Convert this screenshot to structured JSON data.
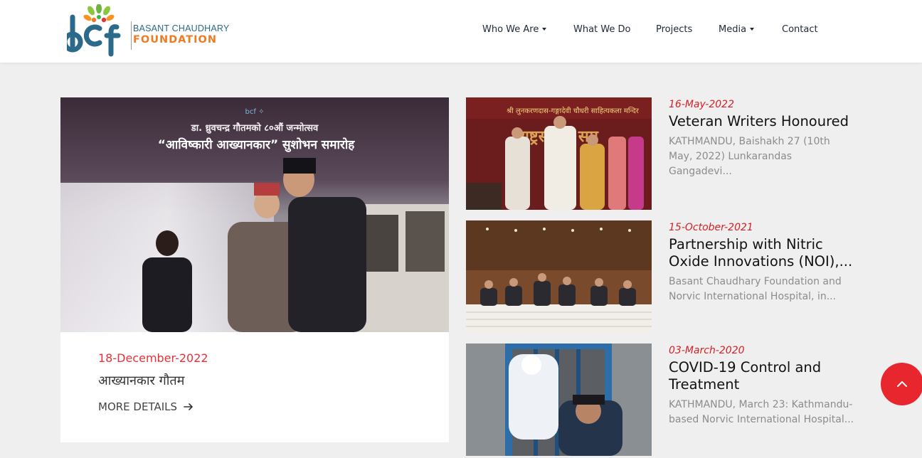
{
  "logo": {
    "line1": "BASANT CHAUDHARY",
    "line2": "FOUNDATION"
  },
  "nav": {
    "items": [
      {
        "label": "Who We Are",
        "dropdown": true
      },
      {
        "label": "What We Do",
        "dropdown": false
      },
      {
        "label": "Projects",
        "dropdown": false
      },
      {
        "label": "Media",
        "dropdown": true
      },
      {
        "label": "Contact",
        "dropdown": false
      }
    ]
  },
  "featured": {
    "date": "18-December-2022",
    "title": "आख्यानकार गौतम",
    "more_label": "MORE DETAILS",
    "image_banner": {
      "line1": "डा. ध्रुवचन्द्र गौतमको ८०औं जन्मोत्सव",
      "line2": "“आविष्कारी आख्यानकार” सुशोभन समारोह"
    }
  },
  "news": [
    {
      "date": "16-May-2022",
      "title": "Veteran Writers Honoured",
      "excerpt": "KATHMANDU, Baishakh 27 (10th May, 2022) Lunkarandas Gangadevi..."
    },
    {
      "date": "15-October-2021",
      "title": "Partnership with Nitric Oxide Innovations (NOI),...",
      "excerpt": "Basant Chaudhary Foundation and Norvic International Hospital, in..."
    },
    {
      "date": "03-March-2020",
      "title": "COVID-19 Control and Treatment",
      "excerpt": "KATHMANDU, March 23: Kathmandu-based Norvic International Hospital..."
    }
  ],
  "colors": {
    "accent_red": "#e8313a",
    "brand_blue": "#2b6a8a",
    "brand_orange": "#ef7a22"
  }
}
